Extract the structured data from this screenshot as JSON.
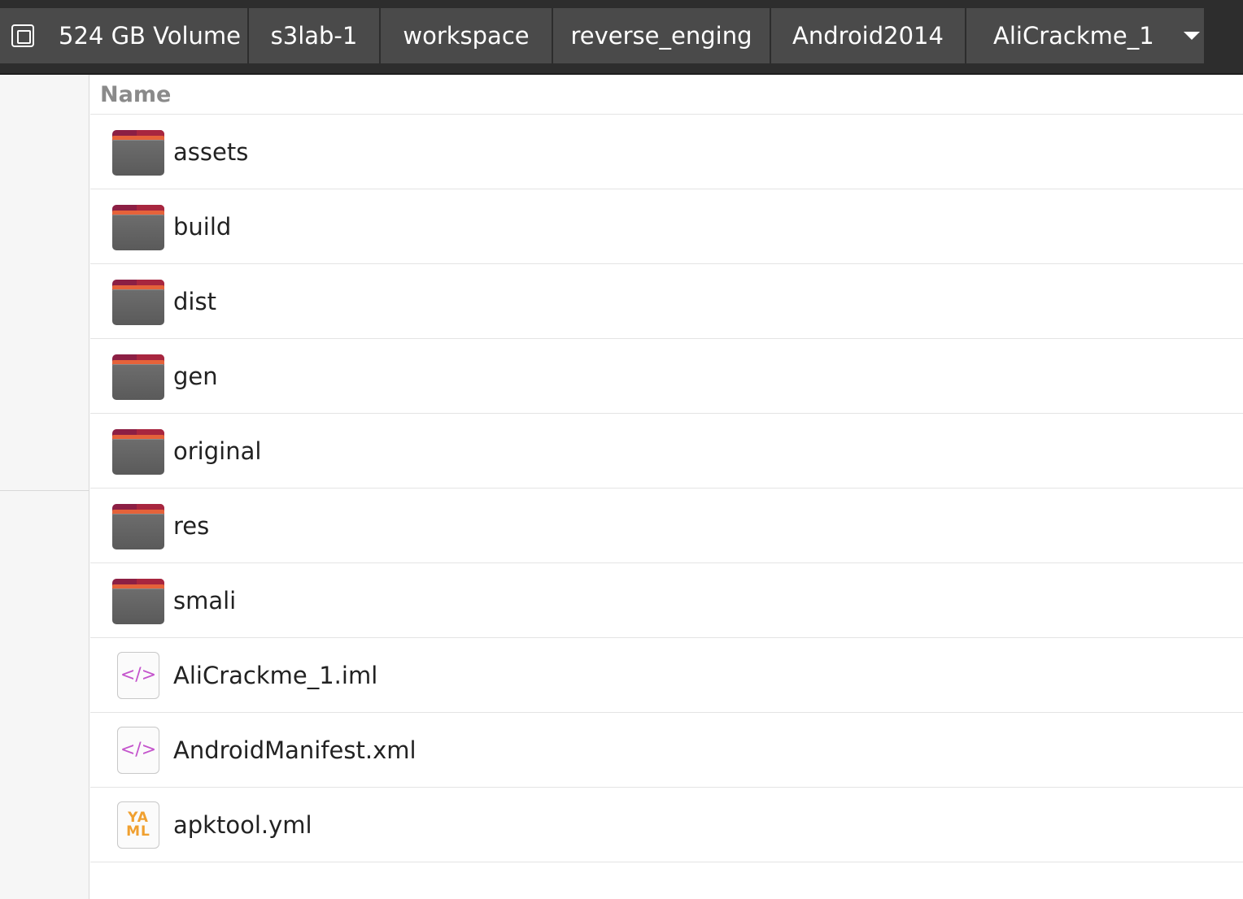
{
  "pathbar": {
    "crumbs": [
      {
        "label": "524 GB Volume",
        "icon": "drive-icon"
      },
      {
        "label": "s3lab-1"
      },
      {
        "label": "workspace"
      },
      {
        "label": "reverse_enging"
      },
      {
        "label": "Android2014"
      },
      {
        "label": "AliCrackme_1",
        "icon": "chevron-down-icon"
      }
    ]
  },
  "list": {
    "column_header": "Name",
    "items": [
      {
        "name": "assets",
        "type": "folder"
      },
      {
        "name": "build",
        "type": "folder"
      },
      {
        "name": "dist",
        "type": "folder"
      },
      {
        "name": "gen",
        "type": "folder"
      },
      {
        "name": "original",
        "type": "folder"
      },
      {
        "name": "res",
        "type": "folder"
      },
      {
        "name": "smali",
        "type": "folder"
      },
      {
        "name": "AliCrackme_1.iml",
        "type": "xml-file"
      },
      {
        "name": "AndroidManifest.xml",
        "type": "xml-file"
      },
      {
        "name": "apktool.yml",
        "type": "yaml-file"
      }
    ]
  },
  "colors": {
    "pathbar_bg": "#2d2d2d",
    "crumb_bg": "#4a4a4a",
    "folder_accent": "#8c1f44",
    "folder_stripe": "#e5623a",
    "code_icon": "#c454cc",
    "yaml_icon": "#f0a030"
  }
}
